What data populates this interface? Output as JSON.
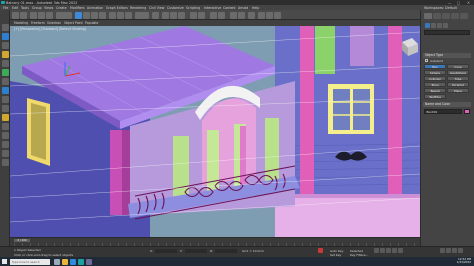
{
  "window": {
    "title": "Balcony 01.max - Autodesk 3ds Max 2022",
    "minimize": "—",
    "maximize": "▢",
    "close": "✕"
  },
  "menu": {
    "items": [
      "File",
      "Edit",
      "Tools",
      "Group",
      "Views",
      "Create",
      "Modifiers",
      "Animation",
      "Graph Editors",
      "Rendering",
      "Civil View",
      "Customize",
      "Scripting",
      "Interactive",
      "Content",
      "Arnold",
      "Help"
    ],
    "workspace": "Workspaces: Default"
  },
  "ribbon": {
    "tabs": [
      "Modeling",
      "Freeform",
      "Selection",
      "Object Paint",
      "Populate"
    ]
  },
  "viewport": {
    "label": "[+] [Perspective] [Standard] [Default Shading]"
  },
  "command_panel": {
    "rollout_object_type": "Object Type",
    "autogrid": "AutoGrid",
    "buttons": [
      "Box",
      "Cone",
      "Sphere",
      "GeoSphere",
      "Cylinder",
      "Tube",
      "Torus",
      "Pyramid",
      "Teapot",
      "Plane",
      "TextPlus"
    ],
    "rollout_name_color": "Name and Color",
    "object_name": "Box001",
    "object_color": "#e25fc1"
  },
  "timeline": {
    "slider_label": "0 / 100"
  },
  "status": {
    "selection": "1 Object Selected",
    "prompt": "Click or click-and-drag to select objects",
    "x_label": "X:",
    "y_label": "Y:",
    "z_label": "Z:",
    "grid": "Grid = 10.0cm",
    "autokey": "Auto Key",
    "selected": "Selected",
    "setkey": "Set Key",
    "keyfilters": "Key Filters..."
  },
  "taskbar": {
    "search_placeholder": "Type here to search",
    "time": "12:52 PM",
    "date": "1/23/2022"
  }
}
